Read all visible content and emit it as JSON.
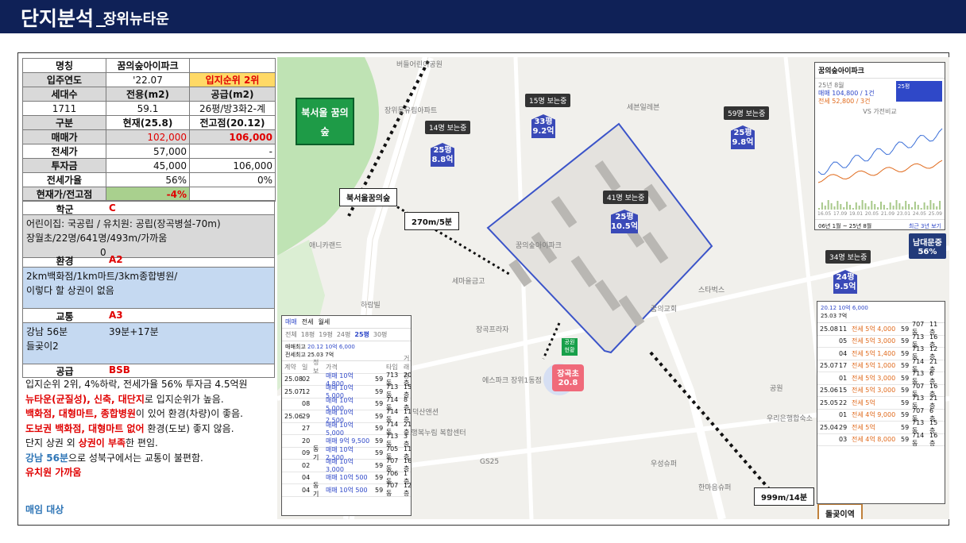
{
  "header": {
    "title": "단지분석",
    "subtitle": "장위뉴타운",
    "underscore": "_"
  },
  "table": {
    "rows": [
      [
        "명칭",
        "꿈의숲아이파크",
        ""
      ],
      [
        "입주연도",
        "'22.07",
        "입지순위 2위"
      ],
      [
        "세대수",
        "전용(m2)",
        "공급(m2)"
      ],
      [
        "1711",
        "59.1",
        "26평/방3화2-계"
      ],
      [
        "구분",
        "현재(25.8)",
        "전고점(20.12)"
      ],
      [
        "매매가",
        "102,000",
        "106,000"
      ],
      [
        "전세가",
        "57,000",
        "-"
      ],
      [
        "투자금",
        "45,000",
        "106,000"
      ],
      [
        "전세가율",
        "56%",
        "0%"
      ],
      [
        "현재가/전고점",
        "-4%",
        ""
      ]
    ]
  },
  "school": {
    "label": "학군",
    "grade": "C",
    "lines": [
      "어린이집: 국공립 / 유치원: 공립(장곡병설-70m)",
      "장월초/22명/641명/493m/가까움",
      "0"
    ]
  },
  "env": {
    "label": "환경",
    "grade": "A2",
    "lines": [
      "2km백화점/1km마트/3km종합병원/",
      "이렇다 할 상권이 없음"
    ]
  },
  "traffic": {
    "label": "교통",
    "grade": "A3",
    "line1a": "강남 56분",
    "line1b": "39분+17분",
    "line2": "들곶이2"
  },
  "supply": {
    "label": "공급",
    "grade": "BSB",
    "s1": "입지순위 2위, 4%하락, 전세가율 56% 투자금 4.5억원",
    "s2_red": "뉴타운(균질성), 신축, 대단지",
    "s2": "로 입지순위가 높음.",
    "s3_red": "백화점, 대형마트, 종합병원",
    "s3": "이 있어 환경(차량)이 좋음.",
    "s4_red": "도보권 백화점, 대형마트 없어",
    "s4": " 환경(도보) 좋지 않음.",
    "s5a": "단지 상권 외 ",
    "s5_red": "상권이 부족",
    "s5b": "한 편임.",
    "s6_blue": "강남 56분",
    "s6": "으로 성북구에서는 교통이 불편함.",
    "s7_red": "유치원 가까움",
    "footer": "매임 대상"
  },
  "map": {
    "park_label": "북서울 꿈의숲",
    "callouts": [
      "북서울꿈의숲",
      "270m/5분",
      "999m/14분",
      "돌곶이역"
    ],
    "markers": [
      {
        "badge": "14명 보는중",
        "size": "25평",
        "price": "8.8억"
      },
      {
        "badge": "15명 보는중",
        "size": "33평",
        "price": "9.2억"
      },
      {
        "badge": "59명 보는중",
        "size": "25평",
        "price": "9.8억"
      },
      {
        "badge": "41명 보는중",
        "size": "25평",
        "price": "10.5억"
      },
      {
        "badge": "34명 보는중",
        "size": "24평",
        "price": "9.5억"
      }
    ],
    "place_labels": [
      "버들어린이공원",
      "장위동유림아파트",
      "꿈의숲아이파크",
      "세븐일레븐",
      "세마을금고",
      "장곡프라자",
      "장곡초",
      "에스파크 장위1동점",
      "덕산앤션",
      "GS25",
      "꿈의교회",
      "스타벅스",
      "우리은행합숙소",
      "장위행복누림 복합센터",
      "우성슈퍼",
      "한마음슈퍼",
      "하람빌",
      "애니카랜드",
      "공원"
    ],
    "school_score": "20.8",
    "school_name": "장곡초",
    "namdaemun": "남대문중",
    "namdaemun_pct": "56%",
    "park_gate": "공원 현황"
  },
  "inset_chart": {
    "title": "꿈의숲아이파크",
    "subtitle": "25년 8월",
    "sale": "매매 104,800 / 1건",
    "jeonse": "전세 52,800 / 3건",
    "legend": "VS 가전비교",
    "filter": "25평",
    "xaxis": [
      "16.05",
      "17.09",
      "19.01",
      "20.05",
      "21.09",
      "23.01",
      "24.05",
      "25.09"
    ],
    "footer_left": "06년 1월 ~ 25년 8월",
    "footer_right": "최근 3년 보기"
  },
  "inset_left": {
    "tabs": [
      "매매",
      "전세",
      "월세"
    ],
    "sizes": [
      "전체",
      "18평",
      "19평",
      "24평",
      "25평",
      "30평"
    ],
    "peak_label": "매매최고",
    "peak": "20.12  10억 6,000",
    "recent_label": "전세최고",
    "recent": "25.03  7억",
    "headers": [
      "계약",
      "일",
      "정보",
      "가격",
      "",
      "타입",
      "거래층"
    ],
    "rows": [
      [
        "25.08",
        "02",
        "",
        "매매 10억 4,800",
        "59",
        "713동",
        "20층"
      ],
      [
        "25.07",
        "12",
        "",
        "매매 10억 5,000",
        "59",
        "713동",
        "15층"
      ],
      [
        "",
        "08",
        "",
        "매매 10억 5,000",
        "59",
        "714동",
        "8층"
      ],
      [
        "25.06",
        "29",
        "",
        "매매 10억 2,500",
        "59",
        "714동",
        "11층"
      ],
      [
        "",
        "27",
        "",
        "매매 10억 5,000",
        "59",
        "714동",
        "21층"
      ],
      [
        "",
        "20",
        "",
        "매매 9억 9,500",
        "59",
        "713동",
        "3층"
      ],
      [
        "",
        "09",
        "동기",
        "매매 10억 2,500",
        "59",
        "705동",
        "11층"
      ],
      [
        "",
        "02",
        "",
        "매매 10억 3,000",
        "59",
        "707동",
        "16층"
      ],
      [
        "",
        "04",
        "",
        "매매 10억 500",
        "59",
        "706동",
        "1층"
      ],
      [
        "",
        "04",
        "동기",
        "매매 10억 500",
        "59",
        "707동",
        "12층"
      ]
    ]
  },
  "inset_right": {
    "peak": "20.12  10억 6,000",
    "recent": "25.03  7억",
    "rows": [
      [
        "25.08",
        "11",
        "전세 5억 4,000",
        "59",
        "707동",
        "11층"
      ],
      [
        "",
        "05",
        "전세 5억 3,000",
        "59",
        "713동",
        "16층"
      ],
      [
        "",
        "04",
        "전세 5억 1,400",
        "59",
        "713동",
        "12층"
      ],
      [
        "25.07",
        "17",
        "전세 5억 1,000",
        "59",
        "714동",
        "21층"
      ],
      [
        "",
        "01",
        "전세 5억 3,000",
        "59",
        "713동",
        "6층"
      ],
      [
        "25.06",
        "15",
        "전세 5억 3,000",
        "59",
        "707동",
        "16층"
      ],
      [
        "25.05",
        "22",
        "전세 5억",
        "59",
        "713동",
        "21층"
      ],
      [
        "",
        "01",
        "전세 4억 9,000",
        "59",
        "707동",
        "6층"
      ],
      [
        "25.04",
        "29",
        "전세 5억",
        "59",
        "713동",
        "15층"
      ],
      [
        "",
        "03",
        "전세 4억 8,000",
        "59",
        "714동",
        "16층"
      ]
    ]
  },
  "colors": {
    "header_bg": "#0f2157",
    "accent_red": "#e00000",
    "accent_blue": "#2e75b6",
    "marker": "#3a4ab8"
  }
}
